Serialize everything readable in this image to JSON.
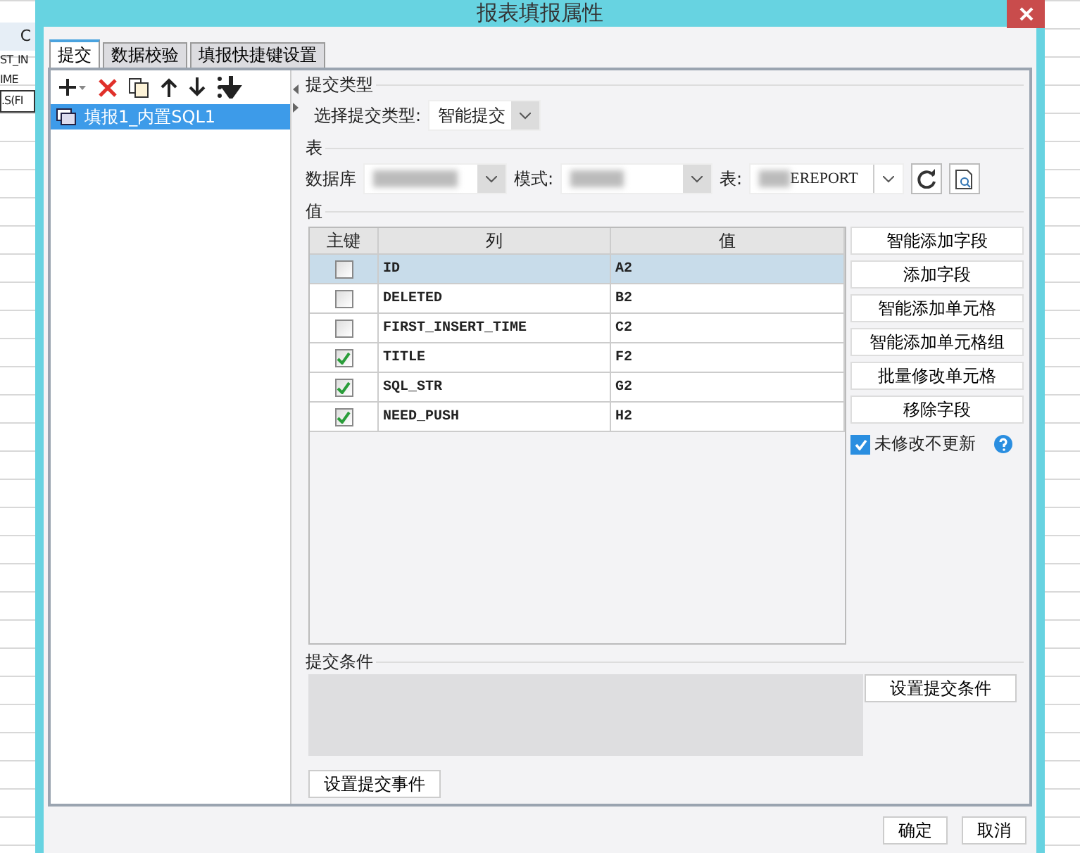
{
  "background_sheet": {
    "column_header": "C",
    "cells": [
      "ST_IN",
      "IME",
      ".S(FI"
    ]
  },
  "window": {
    "title": "报表填报属性"
  },
  "tabs": [
    {
      "label": "提交",
      "selected": true
    },
    {
      "label": "数据校验",
      "selected": false
    },
    {
      "label": "填报快捷键设置",
      "selected": false
    }
  ],
  "sources": [
    {
      "label": "填报1_内置SQL1",
      "selected": true
    }
  ],
  "submit_type": {
    "heading": "提交类型",
    "label": "选择提交类型:",
    "value": "智能提交"
  },
  "table_section": {
    "heading": "表",
    "database_label": "数据库",
    "schema_label": "模式:",
    "table_label": "表:",
    "table_value": "EREPORT"
  },
  "values_section": {
    "heading": "值",
    "columns": [
      "主键",
      "列",
      "值"
    ],
    "rows": [
      {
        "key": false,
        "column": "ID",
        "value": "A2",
        "selected": true
      },
      {
        "key": false,
        "column": "DELETED",
        "value": "B2",
        "selected": false
      },
      {
        "key": false,
        "column": "FIRST_INSERT_TIME",
        "value": "C2",
        "selected": false
      },
      {
        "key": true,
        "column": "TITLE",
        "value": "F2",
        "selected": false
      },
      {
        "key": true,
        "column": "SQL_STR",
        "value": "G2",
        "selected": false
      },
      {
        "key": true,
        "column": "NEED_PUSH",
        "value": "H2",
        "selected": false
      }
    ],
    "buttons": [
      "智能添加字段",
      "添加字段",
      "智能添加单元格",
      "智能添加单元格组",
      "批量修改单元格",
      "移除字段"
    ],
    "unmodified_option": {
      "label": "未修改不更新",
      "checked": true
    }
  },
  "condition_section": {
    "heading": "提交条件",
    "button": "设置提交条件"
  },
  "event_button": "设置提交事件",
  "footer_buttons": [
    "确定",
    "取消"
  ]
}
